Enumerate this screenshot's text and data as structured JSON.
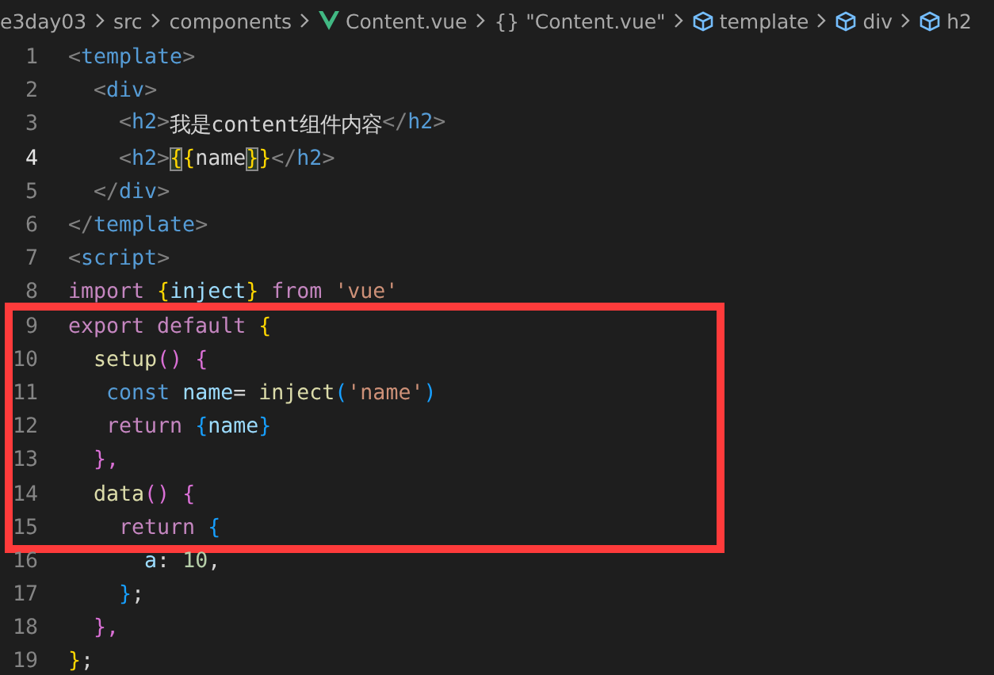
{
  "breadcrumb": [
    {
      "label": "e3day03",
      "kind": "folder"
    },
    {
      "label": "src",
      "kind": "folder"
    },
    {
      "label": "components",
      "kind": "folder"
    },
    {
      "label": "Content.vue",
      "kind": "vue-file"
    },
    {
      "label": "{} \"Content.vue\"",
      "kind": "module"
    },
    {
      "label": "template",
      "kind": "element"
    },
    {
      "label": "div",
      "kind": "element"
    },
    {
      "label": "h2",
      "kind": "element"
    }
  ],
  "code": [
    {
      "kind": "line",
      "number": "1",
      "current": false,
      "tokens": [
        {
          "text": "<",
          "kind": "angle"
        },
        {
          "text": "template",
          "kind": "tag"
        },
        {
          "text": ">",
          "kind": "angle"
        }
      ]
    },
    {
      "kind": "line",
      "number": "2",
      "current": false,
      "tokens": [
        {
          "text": "  <",
          "kind": "angle"
        },
        {
          "text": "div",
          "kind": "tag"
        },
        {
          "text": ">",
          "kind": "angle"
        }
      ]
    },
    {
      "kind": "line",
      "number": "3",
      "current": false,
      "tokens": [
        {
          "text": "    <",
          "kind": "angle"
        },
        {
          "text": "h2",
          "kind": "tag"
        },
        {
          "text": ">",
          "kind": "angle"
        },
        {
          "text": "我是content组件内容",
          "kind": "plain"
        },
        {
          "text": "</",
          "kind": "angle"
        },
        {
          "text": "h2",
          "kind": "tag"
        },
        {
          "text": ">",
          "kind": "angle"
        }
      ]
    },
    {
      "kind": "line",
      "number": "4",
      "current": true,
      "tokens": [
        {
          "text": "    <",
          "kind": "angle"
        },
        {
          "text": "h2",
          "kind": "tag"
        },
        {
          "text": ">",
          "kind": "angle"
        },
        {
          "text": "{",
          "kind": "brace-match"
        },
        {
          "text": "{",
          "kind": "brace"
        },
        {
          "text": "name",
          "kind": "plain"
        },
        {
          "text": "}",
          "kind": "brace-match"
        },
        {
          "text": "}",
          "kind": "brace"
        },
        {
          "text": "</",
          "kind": "angle"
        },
        {
          "text": "h2",
          "kind": "tag"
        },
        {
          "text": ">",
          "kind": "angle"
        }
      ]
    },
    {
      "kind": "line",
      "number": "5",
      "current": false,
      "tokens": [
        {
          "text": "  </",
          "kind": "angle"
        },
        {
          "text": "div",
          "kind": "tag"
        },
        {
          "text": ">",
          "kind": "angle"
        }
      ]
    },
    {
      "kind": "line",
      "number": "6",
      "current": false,
      "tokens": [
        {
          "text": "</",
          "kind": "angle"
        },
        {
          "text": "template",
          "kind": "tag"
        },
        {
          "text": ">",
          "kind": "angle"
        }
      ]
    },
    {
      "kind": "line",
      "number": "7",
      "current": false,
      "tokens": [
        {
          "text": "<",
          "kind": "angle"
        },
        {
          "text": "script",
          "kind": "tag"
        },
        {
          "text": ">",
          "kind": "angle"
        }
      ]
    },
    {
      "kind": "line",
      "number": "8",
      "current": false,
      "tokens": [
        {
          "text": "import ",
          "kind": "keyword"
        },
        {
          "text": "{",
          "kind": "brace"
        },
        {
          "text": "inject",
          "kind": "variable"
        },
        {
          "text": "} ",
          "kind": "brace"
        },
        {
          "text": "from ",
          "kind": "keyword"
        },
        {
          "text": "'vue'",
          "kind": "string"
        }
      ]
    },
    {
      "kind": "highlight",
      "lines": [
        {
          "number": "9",
          "current": false,
          "tokens": [
            {
              "text": "export default ",
              "kind": "keyword"
            },
            {
              "text": "{",
              "kind": "brace"
            }
          ]
        },
        {
          "number": "10",
          "current": false,
          "tokens": [
            {
              "text": "  setup",
              "kind": "function"
            },
            {
              "text": "() {",
              "kind": "paren"
            }
          ]
        },
        {
          "number": "11",
          "current": false,
          "tokens": [
            {
              "text": "   const ",
              "kind": "storage"
            },
            {
              "text": "name",
              "kind": "variable"
            },
            {
              "text": "= ",
              "kind": "plain"
            },
            {
              "text": "inject",
              "kind": "function"
            },
            {
              "text": "(",
              "kind": "bracket"
            },
            {
              "text": "'name'",
              "kind": "string"
            },
            {
              "text": ")",
              "kind": "bracket"
            }
          ]
        },
        {
          "number": "12",
          "current": false,
          "tokens": [
            {
              "text": "   return ",
              "kind": "keyword"
            },
            {
              "text": "{",
              "kind": "bracket"
            },
            {
              "text": "name",
              "kind": "variable"
            },
            {
              "text": "}",
              "kind": "bracket"
            }
          ]
        },
        {
          "number": "13",
          "current": false,
          "tokens": [
            {
              "text": "  },",
              "kind": "paren"
            }
          ]
        },
        {
          "number": "14",
          "current": false,
          "tokens": [
            {
              "text": "  data",
              "kind": "function"
            },
            {
              "text": "() {",
              "kind": "paren"
            }
          ]
        },
        {
          "number": "15",
          "current": false,
          "tokens": [
            {
              "text": "    return ",
              "kind": "keyword"
            },
            {
              "text": "{",
              "kind": "bracket"
            }
          ]
        }
      ]
    },
    {
      "kind": "line",
      "number": "16",
      "current": false,
      "tokens": [
        {
          "text": "      a",
          "kind": "variable"
        },
        {
          "text": ": ",
          "kind": "plain"
        },
        {
          "text": "10",
          "kind": "number"
        },
        {
          "text": ",",
          "kind": "plain"
        }
      ]
    },
    {
      "kind": "line",
      "number": "17",
      "current": false,
      "tokens": [
        {
          "text": "    }",
          "kind": "bracket"
        },
        {
          "text": ";",
          "kind": "plain"
        }
      ]
    },
    {
      "kind": "line",
      "number": "18",
      "current": false,
      "tokens": [
        {
          "text": "  },",
          "kind": "paren"
        }
      ]
    },
    {
      "kind": "line",
      "number": "19",
      "current": false,
      "tokens": [
        {
          "text": "}",
          "kind": "brace"
        },
        {
          "text": ";",
          "kind": "plain"
        }
      ]
    }
  ]
}
